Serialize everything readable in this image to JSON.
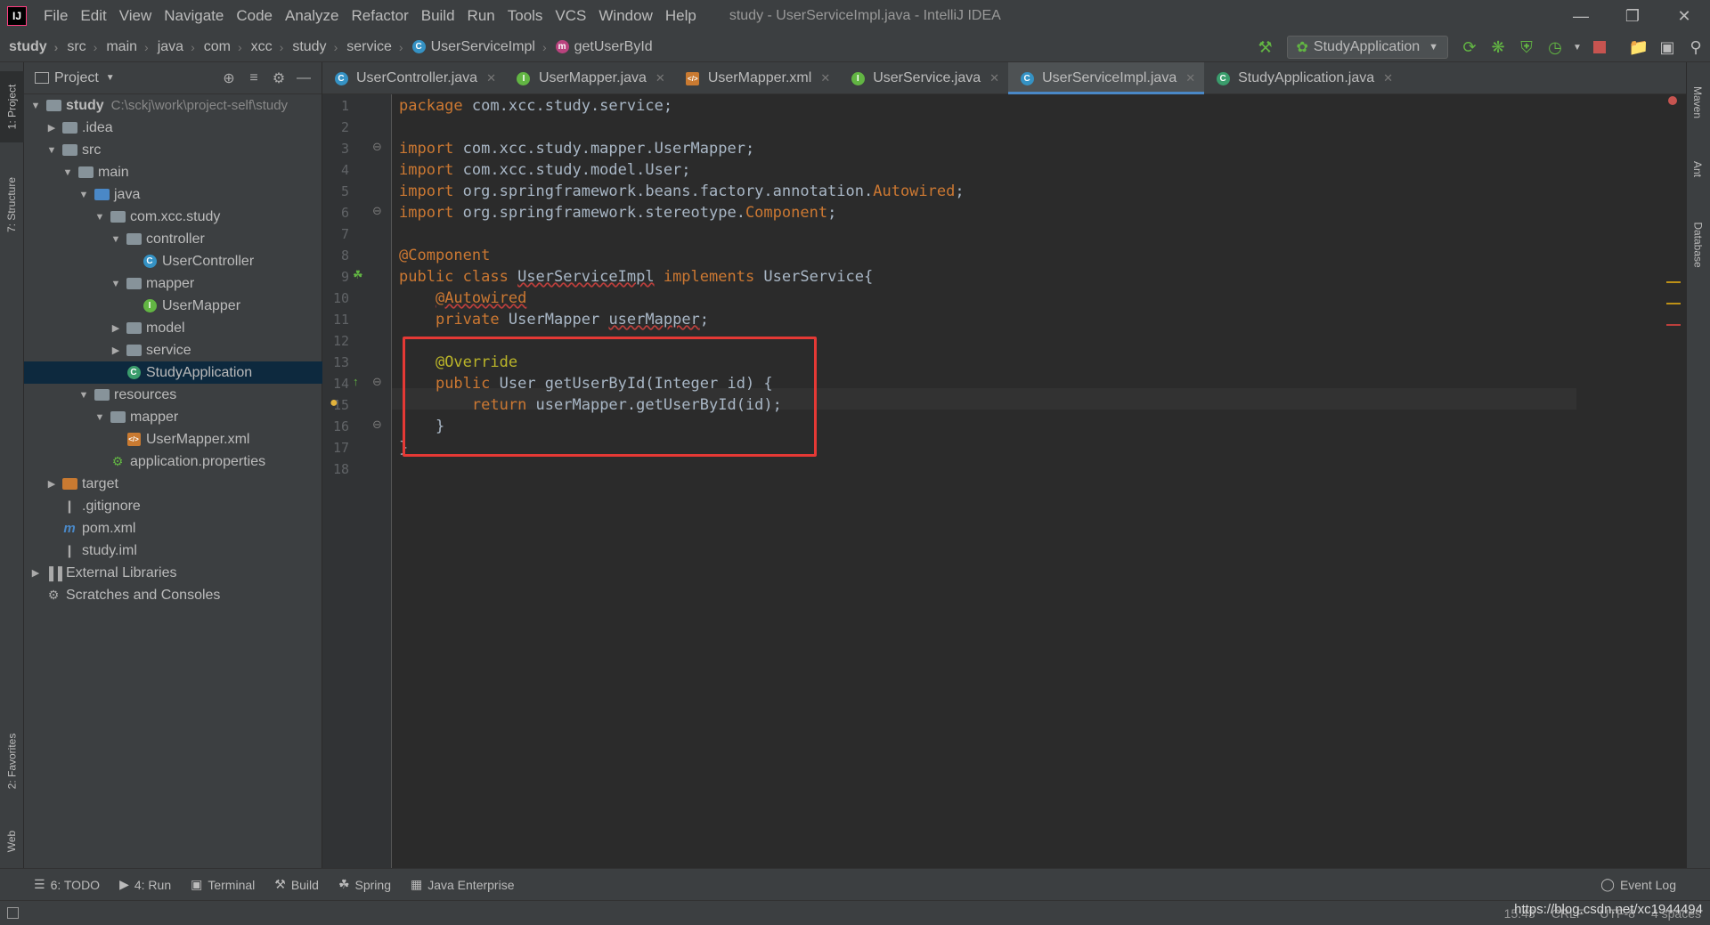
{
  "app": {
    "window_title": "study - UserServiceImpl.java - IntelliJ IDEA",
    "logo": "IJ",
    "menu": [
      "File",
      "Edit",
      "View",
      "Navigate",
      "Code",
      "Analyze",
      "Refactor",
      "Build",
      "Run",
      "Tools",
      "VCS",
      "Window",
      "Help"
    ]
  },
  "breadcrumbs": [
    "study",
    "src",
    "main",
    "java",
    "com",
    "xcc",
    "study",
    "service",
    "UserServiceImpl",
    "getUserById"
  ],
  "toolbar": {
    "run_config": "StudyApplication"
  },
  "left_strip": {
    "project": "1: Project",
    "structure": "7: Structure",
    "favorites": "2: Favorites",
    "web": "Web"
  },
  "right_strip": {
    "maven": "Maven",
    "ant": "Ant",
    "database": "Database"
  },
  "project_panel": {
    "title": "Project",
    "tree": [
      {
        "label": "study",
        "path": "C:\\sckj\\work\\project-self\\study",
        "depth": 0,
        "arrow": "down",
        "icon": "folder"
      },
      {
        "label": ".idea",
        "depth": 1,
        "arrow": "right",
        "icon": "folder"
      },
      {
        "label": "src",
        "depth": 1,
        "arrow": "down",
        "icon": "folder"
      },
      {
        "label": "main",
        "depth": 2,
        "arrow": "down",
        "icon": "folder"
      },
      {
        "label": "java",
        "depth": 3,
        "arrow": "down",
        "icon": "folder-blue"
      },
      {
        "label": "com.xcc.study",
        "depth": 4,
        "arrow": "down",
        "icon": "folder"
      },
      {
        "label": "controller",
        "depth": 5,
        "arrow": "down",
        "icon": "folder"
      },
      {
        "label": "UserController",
        "depth": 6,
        "arrow": "",
        "icon": "class"
      },
      {
        "label": "mapper",
        "depth": 5,
        "arrow": "down",
        "icon": "folder"
      },
      {
        "label": "UserMapper",
        "depth": 6,
        "arrow": "",
        "icon": "interface"
      },
      {
        "label": "model",
        "depth": 5,
        "arrow": "right",
        "icon": "folder"
      },
      {
        "label": "service",
        "depth": 5,
        "arrow": "right",
        "icon": "folder"
      },
      {
        "label": "StudyApplication",
        "depth": 5,
        "arrow": "",
        "icon": "spring-class",
        "selected": true
      },
      {
        "label": "resources",
        "depth": 3,
        "arrow": "down",
        "icon": "folder"
      },
      {
        "label": "mapper",
        "depth": 4,
        "arrow": "down",
        "icon": "folder"
      },
      {
        "label": "UserMapper.xml",
        "depth": 5,
        "arrow": "",
        "icon": "xml"
      },
      {
        "label": "application.properties",
        "depth": 4,
        "arrow": "",
        "icon": "properties"
      },
      {
        "label": "target",
        "depth": 1,
        "arrow": "right",
        "icon": "folder-orange"
      },
      {
        "label": ".gitignore",
        "depth": 1,
        "arrow": "",
        "icon": "file"
      },
      {
        "label": "pom.xml",
        "depth": 1,
        "arrow": "",
        "icon": "maven"
      },
      {
        "label": "study.iml",
        "depth": 1,
        "arrow": "",
        "icon": "file"
      },
      {
        "label": "External Libraries",
        "depth": 0,
        "arrow": "right",
        "icon": "libraries"
      },
      {
        "label": "Scratches and Consoles",
        "depth": 0,
        "arrow": "",
        "icon": "scratches"
      }
    ]
  },
  "editor_tabs": [
    {
      "label": "UserController.java",
      "icon": "class",
      "active": false
    },
    {
      "label": "UserMapper.java",
      "icon": "interface",
      "active": false
    },
    {
      "label": "UserMapper.xml",
      "icon": "xml",
      "active": false
    },
    {
      "label": "UserService.java",
      "icon": "interface",
      "active": false
    },
    {
      "label": "UserServiceImpl.java",
      "icon": "class",
      "active": true
    },
    {
      "label": "StudyApplication.java",
      "icon": "spring-class",
      "active": false
    }
  ],
  "code": {
    "line_numbers": [
      "1",
      "2",
      "3",
      "4",
      "5",
      "6",
      "7",
      "8",
      "9",
      "10",
      "11",
      "12",
      "13",
      "14",
      "15",
      "16",
      "17",
      "18"
    ],
    "lines": [
      [
        {
          "t": "package",
          "c": "kw"
        },
        {
          "t": " com.xcc.study.service;",
          "c": ""
        }
      ],
      [],
      [
        {
          "t": "import",
          "c": "kw"
        },
        {
          "t": " com.xcc.study.mapper.UserMapper;",
          "c": ""
        }
      ],
      [
        {
          "t": "import",
          "c": "kw"
        },
        {
          "t": " com.xcc.study.model.User;",
          "c": ""
        }
      ],
      [
        {
          "t": "import",
          "c": "kw"
        },
        {
          "t": " org.springframework.beans.factory.annotation.",
          "c": ""
        },
        {
          "t": "Autowired",
          "c": "err-ann"
        },
        {
          "t": ";",
          "c": ""
        }
      ],
      [
        {
          "t": "import",
          "c": "kw"
        },
        {
          "t": " org.springframework.stereotype.",
          "c": ""
        },
        {
          "t": "Component",
          "c": "err-ann"
        },
        {
          "t": ";",
          "c": ""
        }
      ],
      [],
      [
        {
          "t": "@Component",
          "c": "err-ann"
        }
      ],
      [
        {
          "t": "public class ",
          "c": "kw"
        },
        {
          "t": "UserServiceImpl",
          "c": "red-under"
        },
        {
          "t": " implements ",
          "c": "kw"
        },
        {
          "t": "UserService{",
          "c": ""
        }
      ],
      [
        {
          "t": "    ",
          "c": ""
        },
        {
          "t": "@Autowired",
          "c": "err-ann red-under"
        }
      ],
      [
        {
          "t": "    ",
          "c": ""
        },
        {
          "t": "private ",
          "c": "kw"
        },
        {
          "t": "UserMapper ",
          "c": ""
        },
        {
          "t": "userMapper",
          "c": "red-under"
        },
        {
          "t": ";",
          "c": ""
        }
      ],
      [],
      [
        {
          "t": "    ",
          "c": ""
        },
        {
          "t": "@Override",
          "c": "ann"
        }
      ],
      [
        {
          "t": "    ",
          "c": ""
        },
        {
          "t": "public ",
          "c": "kw"
        },
        {
          "t": "User getUserById(Integer id) {",
          "c": ""
        }
      ],
      [
        {
          "t": "        ",
          "c": ""
        },
        {
          "t": "return ",
          "c": "kw"
        },
        {
          "t": "userMapper.getUserById(id);",
          "c": ""
        }
      ],
      [
        {
          "t": "    }",
          "c": ""
        }
      ],
      [
        {
          "t": "}",
          "c": ""
        }
      ],
      []
    ]
  },
  "bottom_tools": [
    {
      "label": "6: TODO",
      "icon": "todo-icon"
    },
    {
      "label": "4: Run",
      "icon": "run-icon"
    },
    {
      "label": "Terminal",
      "icon": "terminal-icon"
    },
    {
      "label": "Build",
      "icon": "build-icon"
    },
    {
      "label": "Spring",
      "icon": "spring-icon"
    },
    {
      "label": "Java Enterprise",
      "icon": "java-enterprise-icon"
    }
  ],
  "event_log": "Event Log",
  "status": {
    "position": "15:43",
    "line_sep": "CRLF",
    "encoding": "UTF-8",
    "indent": "4 spaces"
  },
  "watermark": "https://blog.csdn.net/xc1944494",
  "colors": {
    "accent": "#4a88c7",
    "highlight_box": "#e53935",
    "keyword": "#cc7832",
    "annotation": "#bbb529",
    "selection": "#0d293e"
  }
}
